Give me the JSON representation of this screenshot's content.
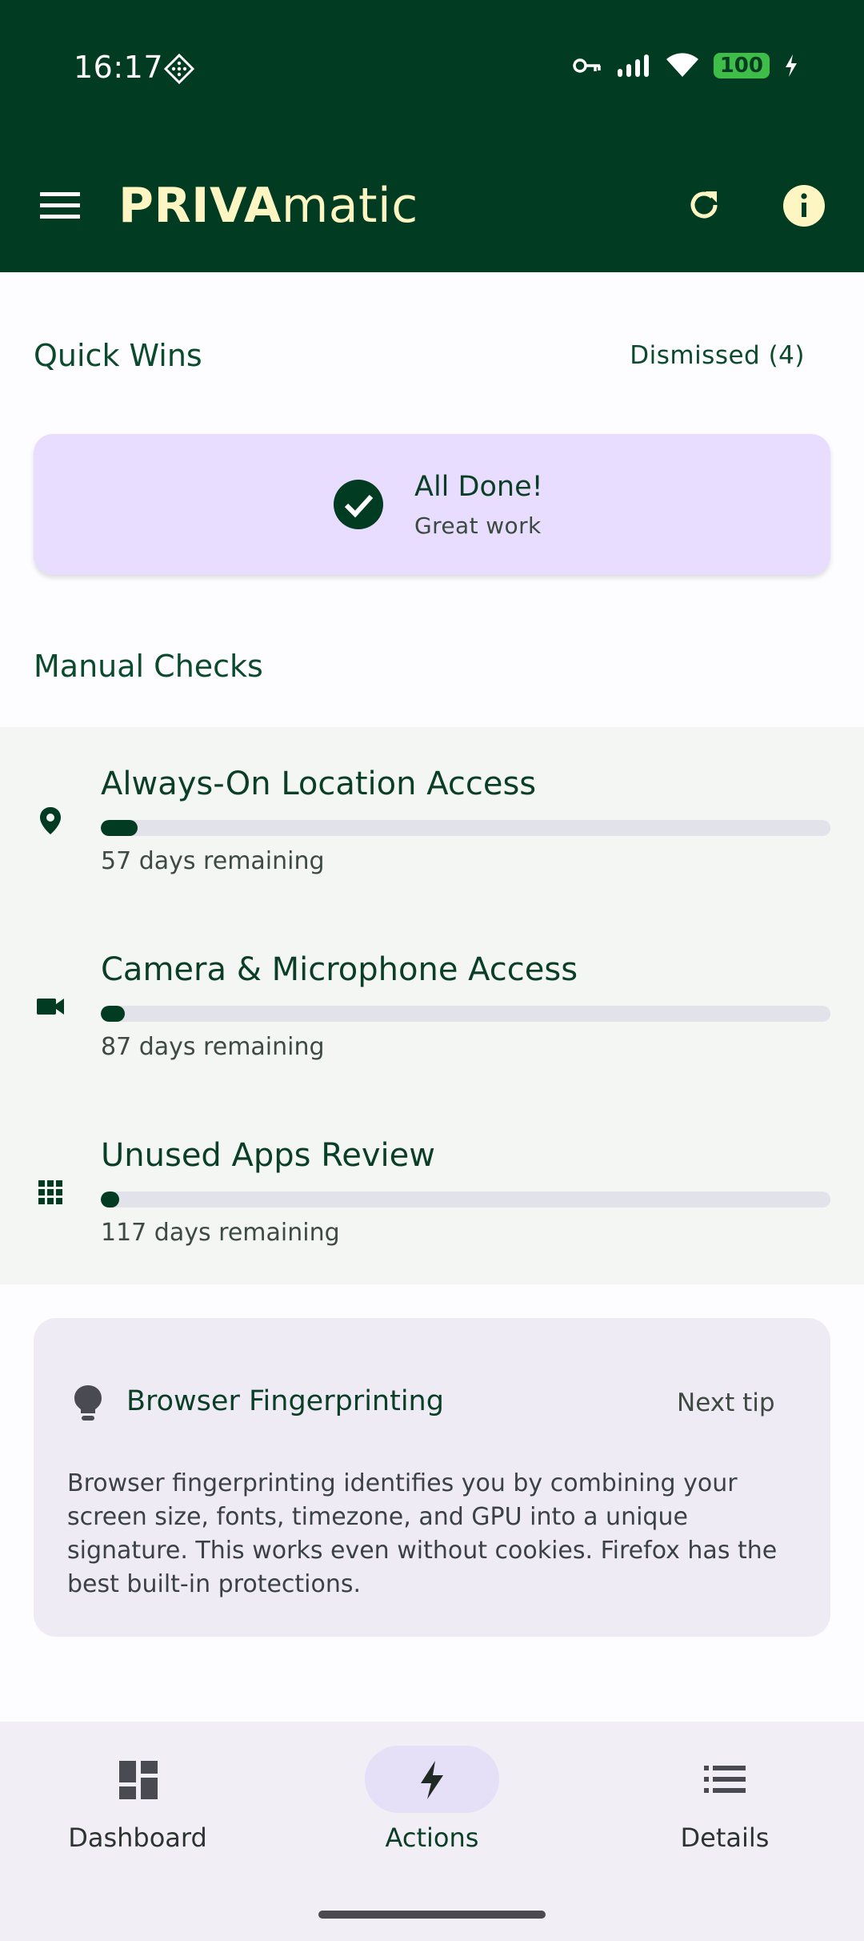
{
  "status_bar": {
    "time": "16:17",
    "battery": "100",
    "icons": [
      "diamond-icon",
      "vpn-key-icon",
      "signal-icon",
      "wifi-icon",
      "battery-icon",
      "charging-icon"
    ]
  },
  "app_bar": {
    "title_bold": "PRIVA",
    "title_rest": "matic",
    "icons": [
      "menu-icon",
      "refresh-icon",
      "info-icon"
    ]
  },
  "quick_wins": {
    "title": "Quick Wins",
    "dismissed_label": "Dismissed (4)",
    "done_title": "All Done!",
    "done_subtitle": "Great work"
  },
  "manual_checks": {
    "title": "Manual Checks",
    "items": [
      {
        "title": "Always-On Location Access",
        "remaining": "57 days remaining",
        "progress": 0.05,
        "icon": "location-pin-icon"
      },
      {
        "title": "Camera & Microphone Access",
        "remaining": "87 days remaining",
        "progress": 0.033,
        "icon": "videocam-icon"
      },
      {
        "title": "Unused Apps Review",
        "remaining": "117 days remaining",
        "progress": 0.025,
        "icon": "apps-grid-icon"
      }
    ]
  },
  "tip": {
    "title": "Browser Fingerprinting",
    "next_label": "Next tip",
    "body": "Browser fingerprinting identifies you by combining your screen size, fonts, timezone, and GPU into a unique signature. This works even without cookies. Firefox has the best built-in protections.",
    "icon": "lightbulb-icon"
  },
  "bottom_nav": {
    "items": [
      {
        "label": "Dashboard",
        "icon": "dashboard-icon"
      },
      {
        "label": "Actions",
        "icon": "bolt-icon",
        "selected": true
      },
      {
        "label": "Details",
        "icon": "list-icon"
      }
    ]
  },
  "colors": {
    "primary_dark": "#013b22",
    "title_cream": "#fdf5c2",
    "done_card": "#e8ddff",
    "battery_green": "#3fbd49"
  }
}
